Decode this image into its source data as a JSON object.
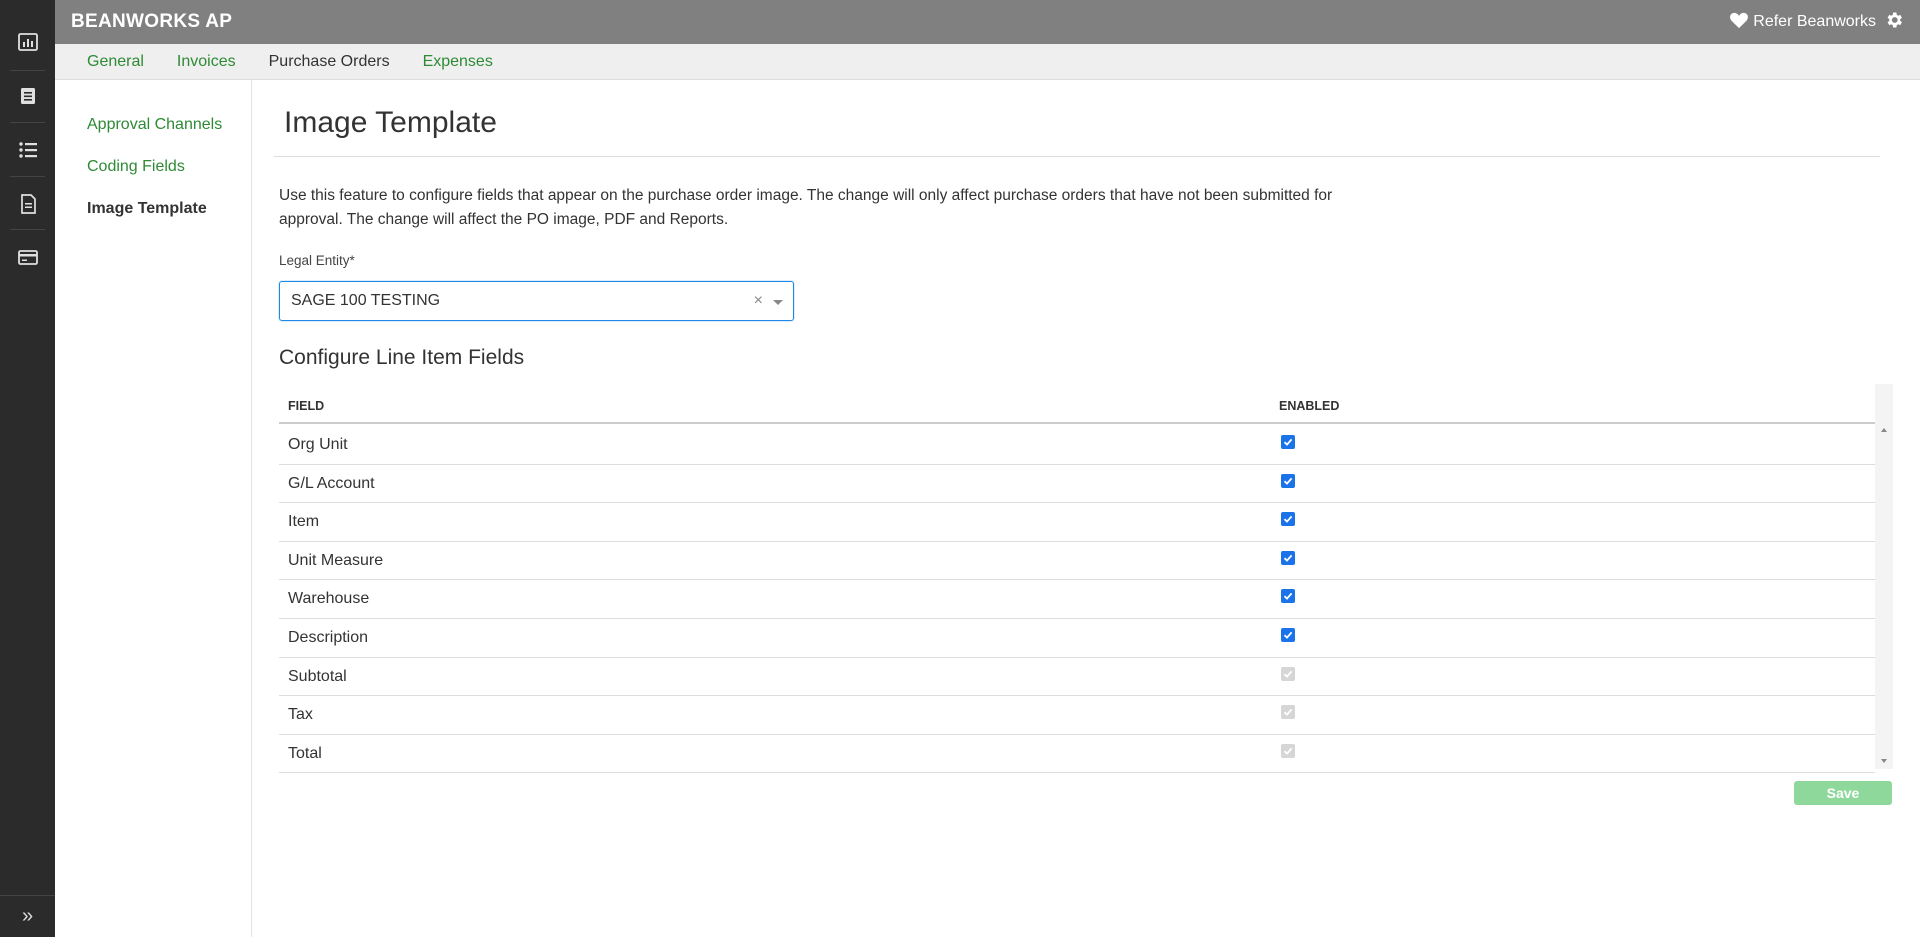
{
  "app": {
    "title": "BEANWORKS AP"
  },
  "rail": {
    "icons": [
      "dashboard-icon",
      "document-list-icon",
      "list-icon",
      "report-icon",
      "card-icon"
    ],
    "expand_icon": "double-chevron-right-icon"
  },
  "header": {
    "refer_label": "Refer Beanworks",
    "refer_icon": "heart-icon",
    "settings_icon": "gear-icon"
  },
  "tabs": [
    {
      "label": "General",
      "active": false
    },
    {
      "label": "Invoices",
      "active": false
    },
    {
      "label": "Purchase Orders",
      "active": true
    },
    {
      "label": "Expenses",
      "active": false
    }
  ],
  "subnav": {
    "items": [
      {
        "label": "Approval Channels",
        "active": false
      },
      {
        "label": "Coding Fields",
        "active": false
      },
      {
        "label": "Image Template",
        "active": true
      }
    ]
  },
  "main": {
    "title": "Image Template",
    "description": "Use this feature to configure fields that appear on the purchase order image. The change will only affect purchase orders that have not been submitted for approval. The change will affect the PO image, PDF and Reports.",
    "legal_entity": {
      "label": "Legal Entity*",
      "value": "SAGE 100 TESTING",
      "clear_glyph": "×"
    },
    "section_title": "Configure Line Item Fields",
    "table": {
      "headers": {
        "field": "FIELD",
        "enabled": "ENABLED"
      },
      "rows": [
        {
          "field": "Org Unit",
          "enabled": true,
          "editable": true
        },
        {
          "field": "G/L Account",
          "enabled": true,
          "editable": true
        },
        {
          "field": "Item",
          "enabled": true,
          "editable": true
        },
        {
          "field": "Unit Measure",
          "enabled": true,
          "editable": true
        },
        {
          "field": "Warehouse",
          "enabled": true,
          "editable": true
        },
        {
          "field": "Description",
          "enabled": true,
          "editable": true
        },
        {
          "field": "Subtotal",
          "enabled": true,
          "editable": false
        },
        {
          "field": "Tax",
          "enabled": true,
          "editable": false
        },
        {
          "field": "Total",
          "enabled": true,
          "editable": false
        }
      ]
    },
    "save_label": "Save"
  },
  "colors": {
    "accent_green": "#2e8a35",
    "topbar": "#808080",
    "rail": "#2b2b2b",
    "checkbox_blue": "#1a73e8",
    "save_button": "#8fd89c"
  }
}
